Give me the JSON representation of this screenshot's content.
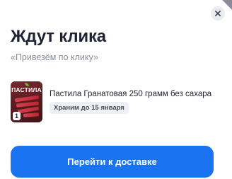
{
  "dialog": {
    "title": "Ждут клика",
    "subtitle": "«Привезём по клику»",
    "close_icon": "close-icon"
  },
  "product": {
    "thumbnail_label": "ПАСТИЛА",
    "quantity": "1",
    "name": "Пастила Гранатовая 250 грамм без сахара",
    "storage_note": "Храним до 15 января"
  },
  "cta": {
    "label": "Перейти к доставке",
    "color": "#1a73f0"
  }
}
